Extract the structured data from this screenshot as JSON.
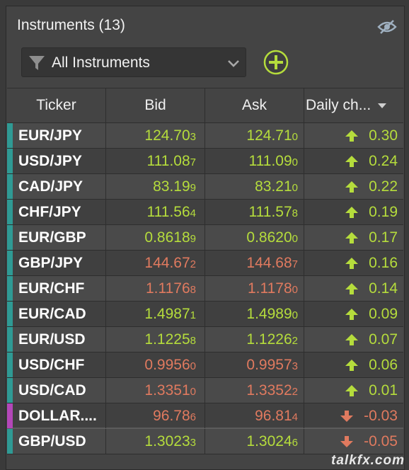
{
  "panel": {
    "title": "Instruments (13)",
    "watermark": "talkfx.com"
  },
  "filter": {
    "label": "All Instruments"
  },
  "columns": {
    "ticker": "Ticker",
    "bid": "Bid",
    "ask": "Ask",
    "change": "Daily ch..."
  },
  "colors": {
    "up": "#b5dc3c",
    "down": "#e07a5f",
    "tealMarker": "#2f9a94",
    "purpleMarker": "#b347b8"
  },
  "rows": [
    {
      "ticker": "EUR/JPY",
      "bidMain": "124.70",
      "bidPip": "3",
      "askMain": "124.71",
      "askPip": "0",
      "change": "0.30",
      "dir": "up",
      "priceDir": "up",
      "marker": "teal"
    },
    {
      "ticker": "USD/JPY",
      "bidMain": "111.08",
      "bidPip": "7",
      "askMain": "111.09",
      "askPip": "0",
      "change": "0.24",
      "dir": "up",
      "priceDir": "up",
      "marker": "teal"
    },
    {
      "ticker": "CAD/JPY",
      "bidMain": "83.19",
      "bidPip": "9",
      "askMain": "83.21",
      "askPip": "0",
      "change": "0.22",
      "dir": "up",
      "priceDir": "up",
      "marker": "teal"
    },
    {
      "ticker": "CHF/JPY",
      "bidMain": "111.56",
      "bidPip": "4",
      "askMain": "111.57",
      "askPip": "8",
      "change": "0.19",
      "dir": "up",
      "priceDir": "up",
      "marker": "teal"
    },
    {
      "ticker": "EUR/GBP",
      "bidMain": "0.8618",
      "bidPip": "9",
      "askMain": "0.8620",
      "askPip": "0",
      "change": "0.17",
      "dir": "up",
      "priceDir": "up",
      "marker": "teal"
    },
    {
      "ticker": "GBP/JPY",
      "bidMain": "144.67",
      "bidPip": "2",
      "askMain": "144.68",
      "askPip": "7",
      "change": "0.16",
      "dir": "up",
      "priceDir": "down",
      "marker": "teal"
    },
    {
      "ticker": "EUR/CHF",
      "bidMain": "1.1176",
      "bidPip": "8",
      "askMain": "1.1178",
      "askPip": "0",
      "change": "0.14",
      "dir": "up",
      "priceDir": "down",
      "marker": "teal"
    },
    {
      "ticker": "EUR/CAD",
      "bidMain": "1.4987",
      "bidPip": "1",
      "askMain": "1.4989",
      "askPip": "0",
      "change": "0.09",
      "dir": "up",
      "priceDir": "up",
      "marker": "teal"
    },
    {
      "ticker": "EUR/USD",
      "bidMain": "1.1225",
      "bidPip": "8",
      "askMain": "1.1226",
      "askPip": "2",
      "change": "0.07",
      "dir": "up",
      "priceDir": "up",
      "marker": "teal"
    },
    {
      "ticker": "USD/CHF",
      "bidMain": "0.9956",
      "bidPip": "0",
      "askMain": "0.9957",
      "askPip": "3",
      "change": "0.06",
      "dir": "up",
      "priceDir": "down",
      "marker": "teal"
    },
    {
      "ticker": "USD/CAD",
      "bidMain": "1.3351",
      "bidPip": "0",
      "askMain": "1.3352",
      "askPip": "2",
      "change": "0.01",
      "dir": "up",
      "priceDir": "down",
      "marker": "teal"
    },
    {
      "ticker": "DOLLAR....",
      "bidMain": "96.78",
      "bidPip": "6",
      "askMain": "96.81",
      "askPip": "4",
      "change": "-0.03",
      "dir": "down",
      "priceDir": "down",
      "marker": "purple"
    },
    {
      "ticker": "GBP/USD",
      "bidMain": "1.3023",
      "bidPip": "3",
      "askMain": "1.3024",
      "askPip": "6",
      "change": "-0.05",
      "dir": "down",
      "priceDir": "up",
      "marker": "teal"
    }
  ]
}
